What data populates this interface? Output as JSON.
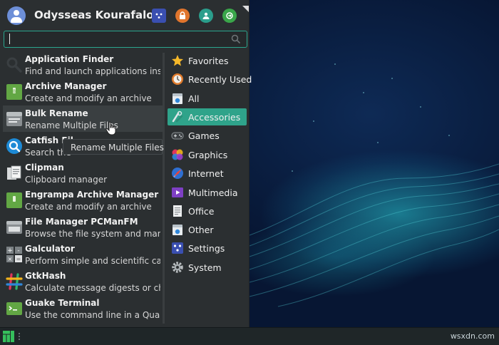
{
  "user": {
    "name": "Odysseas Kourafalos"
  },
  "header_buttons": [
    {
      "icon": "settings-manager-icon"
    },
    {
      "icon": "lock-screen-icon"
    },
    {
      "icon": "switch-user-icon"
    },
    {
      "icon": "logout-icon"
    }
  ],
  "search": {
    "value": "",
    "placeholder": ""
  },
  "apps": [
    {
      "name": "Application Finder",
      "desc": "Find and launch applications instal...",
      "icon": "magnifier-icon"
    },
    {
      "name": "Archive Manager",
      "desc": "Create and modify an archive",
      "icon": "archive-icon"
    },
    {
      "name": "Bulk Rename",
      "desc": "Rename Multiple Files",
      "icon": "bulk-rename-icon"
    },
    {
      "name": "Catfish Fil",
      "desc": "Search the",
      "icon": "catfish-icon"
    },
    {
      "name": "Clipman",
      "desc": "Clipboard manager",
      "icon": "clipboard-icon"
    },
    {
      "name": "Engrampa Archive Manager",
      "desc": "Create and modify an archive",
      "icon": "archive-icon"
    },
    {
      "name": "File Manager PCManFM",
      "desc": "Browse the file system and mana...",
      "icon": "file-manager-icon"
    },
    {
      "name": "Galculator",
      "desc": "Perform simple and scientific calc...",
      "icon": "calculator-icon"
    },
    {
      "name": "GtkHash",
      "desc": "Calculate message digests or che...",
      "icon": "hash-icon"
    },
    {
      "name": "Guake Terminal",
      "desc": "Use the command line in a Quake...",
      "icon": "terminal-icon"
    }
  ],
  "tooltip": "Rename Multiple Files",
  "categories": [
    {
      "label": "Favorites",
      "icon": "star-icon"
    },
    {
      "label": "Recently Used",
      "icon": "clock-icon"
    },
    {
      "label": "All",
      "icon": "all-apps-icon"
    },
    {
      "label": "Accessories",
      "icon": "accessories-icon",
      "active": true
    },
    {
      "label": "Games",
      "icon": "gamepad-icon"
    },
    {
      "label": "Graphics",
      "icon": "graphics-icon"
    },
    {
      "label": "Internet",
      "icon": "globe-icon"
    },
    {
      "label": "Multimedia",
      "icon": "multimedia-icon"
    },
    {
      "label": "Office",
      "icon": "document-icon"
    },
    {
      "label": "Other",
      "icon": "other-icon"
    },
    {
      "label": "Settings",
      "icon": "settings-icon"
    },
    {
      "label": "System",
      "icon": "gear-icon"
    }
  ],
  "taskbar": {
    "watermark": "wsxdn.com"
  },
  "colors": {
    "accent": "#2fa38a",
    "panel": "#2b2f31",
    "taskbar": "#1f2628"
  }
}
